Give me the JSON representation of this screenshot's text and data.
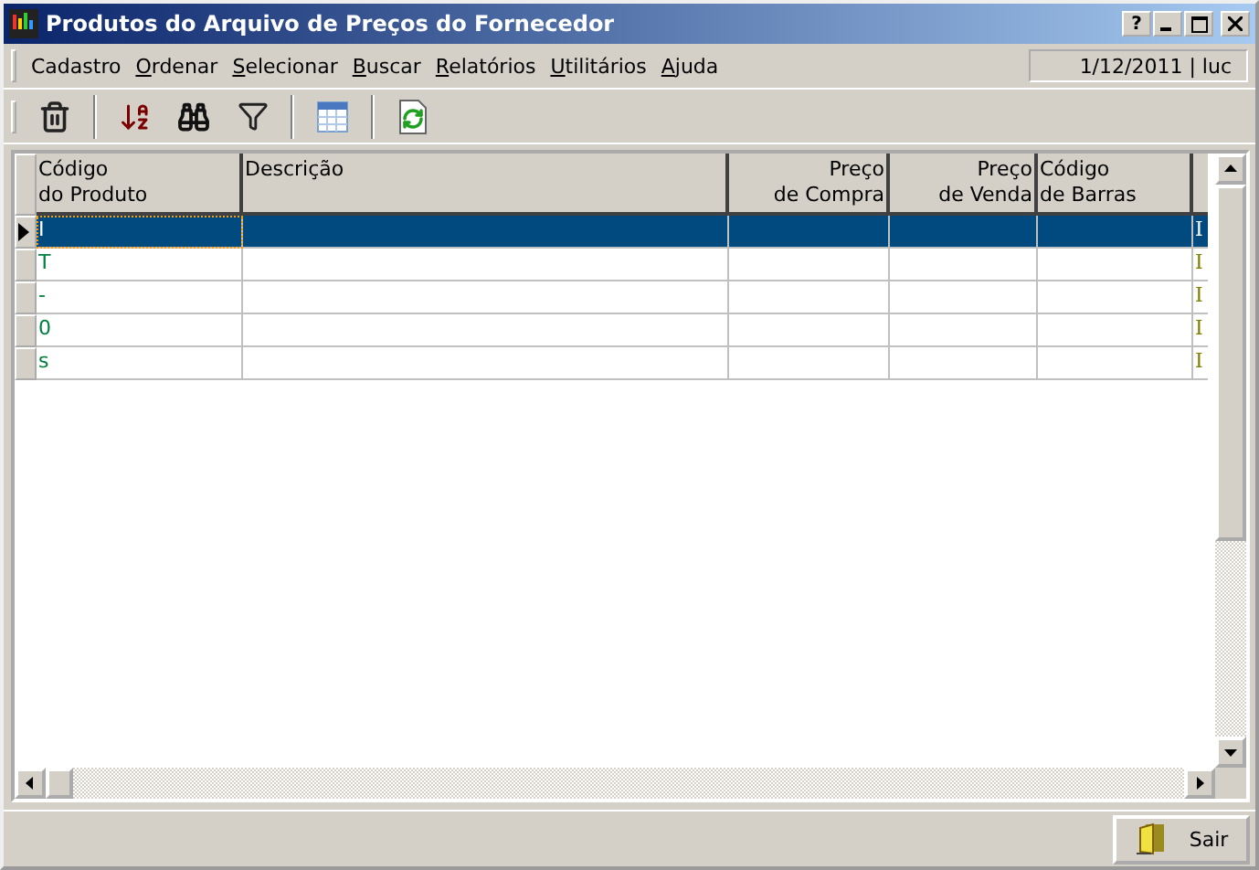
{
  "window": {
    "title": "Produtos do Arquivo de Preços do Fornecedor",
    "help_button": "?"
  },
  "menu": [
    {
      "label": "Cadastro",
      "mnemonic": false
    },
    {
      "label": "Ordenar",
      "mnemonic": true
    },
    {
      "label": "Selecionar",
      "mnemonic": true
    },
    {
      "label": "Buscar",
      "mnemonic": true
    },
    {
      "label": "Relatórios",
      "mnemonic": true
    },
    {
      "label": "Utilitários",
      "mnemonic": true
    },
    {
      "label": "Ajuda",
      "mnemonic": true
    }
  ],
  "status": "1/12/2011 | luc",
  "toolbar": [
    {
      "kind": "trash"
    },
    {
      "kind": "separator"
    },
    {
      "kind": "sort"
    },
    {
      "kind": "binoculars"
    },
    {
      "kind": "filter"
    },
    {
      "kind": "separator"
    },
    {
      "kind": "table"
    },
    {
      "kind": "separator"
    },
    {
      "kind": "refresh"
    }
  ],
  "table": {
    "columns": [
      {
        "label": "Código\ndo Produto",
        "kind": "text"
      },
      {
        "label": "Descrição",
        "kind": "text"
      },
      {
        "label": "Preço\nde Compra",
        "kind": "number"
      },
      {
        "label": "Preço\nde Venda",
        "kind": "number"
      },
      {
        "label": "Código\nde Barras",
        "kind": "text"
      }
    ],
    "rows": [
      {
        "selected": true,
        "code": "I",
        "column_6": "I"
      },
      {
        "selected": false,
        "code": "T",
        "column_6": "I"
      },
      {
        "selected": false,
        "code": "-",
        "column_6": "I"
      },
      {
        "selected": false,
        "code": "0",
        "column_6": "I"
      },
      {
        "selected": false,
        "code": "s",
        "column_6": "I"
      }
    ]
  },
  "buttons": [
    {
      "label": "Sair"
    }
  ]
}
